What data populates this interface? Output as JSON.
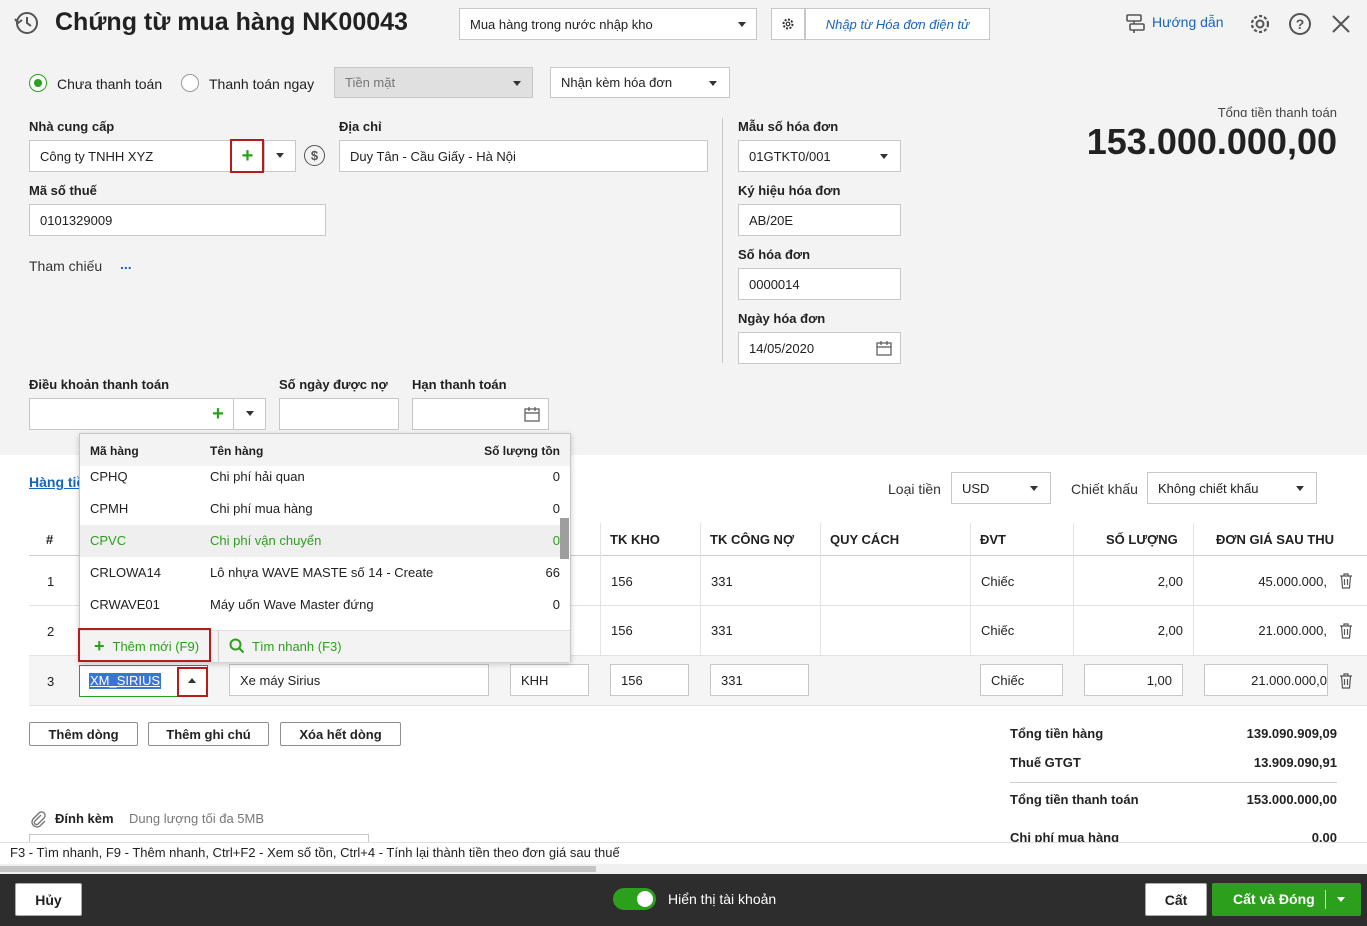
{
  "header": {
    "title": "Chứng từ mua hàng NK00043",
    "doc_type": "Mua hàng trong nước nhập kho",
    "import_einvoice": "Nhập từ Hóa đơn điện tử",
    "help": "Hướng dẫn"
  },
  "payment": {
    "unpaid": "Chưa thanh toán",
    "pay_now": "Thanh toán ngay",
    "method": "Tiền mặt",
    "invoice_mode": "Nhận kèm hóa đơn"
  },
  "total": {
    "label": "Tổng tiền thanh toán",
    "value": "153.000.000,00"
  },
  "supplier": {
    "label": "Nhà cung cấp",
    "value": "Công ty TNHH XYZ",
    "address_label": "Địa chỉ",
    "address": "Duy Tân - Cầu Giấy - Hà Nội",
    "tax_label": "Mã số thuế",
    "tax": "0101329009",
    "ref_label": "Tham chiếu",
    "ref_value": "..."
  },
  "invoice": {
    "form_label": "Mẫu số hóa đơn",
    "form": "01GTKT0/001",
    "sign_label": "Ký hiệu hóa đơn",
    "sign": "AB/20E",
    "number_label": "Số hóa đơn",
    "number": "0000014",
    "date_label": "Ngày hóa đơn",
    "date": "14/05/2020"
  },
  "terms": {
    "terms_label": "Điều khoản thanh toán",
    "days_label": "Số ngày được nợ",
    "due_label": "Hạn thanh toán"
  },
  "tabs": {
    "goods": "Hàng tiề"
  },
  "currency": {
    "label": "Loại tiền",
    "value": "USD",
    "discount_label": "Chiết khấu",
    "discount": "Không chiết khấu"
  },
  "columns": {
    "num": "#",
    "tk_kho": "TK KHO",
    "tk_cong_no": "TK CÔNG NỢ",
    "quy_cach": "QUY CÁCH",
    "dvt": "ĐVT",
    "so_luong": "SỐ LƯỢNG",
    "don_gia": "ĐƠN GIÁ SAU THU"
  },
  "rows": [
    {
      "num": "1",
      "tk_kho": "156",
      "tk_cong_no": "331",
      "dvt": "Chiếc",
      "so_luong": "2,00",
      "don_gia": "45.000.000,"
    },
    {
      "num": "2",
      "tk_kho": "156",
      "tk_cong_no": "331",
      "dvt": "Chiếc",
      "so_luong": "2,00",
      "don_gia": "21.000.000,"
    },
    {
      "num": "3",
      "code": "XM_SIRIUS",
      "name": "Xe máy Sirius",
      "unit_code": "KHH",
      "tk_kho": "156",
      "tk_cong_no": "331",
      "dvt": "Chiếc",
      "so_luong": "1,00",
      "don_gia": "21.000.000,0"
    }
  ],
  "dropdown": {
    "col_code": "Mã hàng",
    "col_name": "Tên hàng",
    "col_stock": "Số lượng tồn",
    "items": [
      {
        "code": "CPHQ",
        "name": "Chi phí hải quan",
        "stock": "0"
      },
      {
        "code": "CPMH",
        "name": "Chi phí mua hàng",
        "stock": "0"
      },
      {
        "code": "CPVC",
        "name": "Chi phí vận chuyển",
        "stock": "0"
      },
      {
        "code": "CRLOWA14",
        "name": "Lô nhựa WAVE MASTE số 14 - Create",
        "stock": "66"
      },
      {
        "code": "CRWAVE01",
        "name": "Máy uốn Wave Master đứng",
        "stock": "0"
      }
    ],
    "add_new": "Thêm mới (F9)",
    "quick_search": "Tìm nhanh (F3)"
  },
  "actions": {
    "add_row": "Thêm dòng",
    "add_note": "Thêm ghi chú",
    "clear_rows": "Xóa hết dòng"
  },
  "summary": {
    "goods_label": "Tổng tiền hàng",
    "goods": "139.090.909,09",
    "vat_label": "Thuế GTGT",
    "vat": "13.909.090,91",
    "total_label": "Tổng tiền thanh toán",
    "total": "153.000.000,00",
    "cost_label": "Chi phí mua hàng",
    "cost": "0,00"
  },
  "attach": {
    "label": "Đính kèm",
    "hint": "Dung lượng tối đa 5MB"
  },
  "hint_bar": "F3 - Tìm nhanh, F9 - Thêm nhanh, Ctrl+F2 - Xem số tồn, Ctrl+4 - Tính lại thành tiền theo đơn giá sau thuế",
  "footer": {
    "cancel": "Hủy",
    "show_account": "Hiển thị tài khoản",
    "save": "Cất",
    "save_close": "Cất và Đóng"
  },
  "colors": {
    "accent": "#2ca01c",
    "link": "#1565c0",
    "footer_bg": "#2d2d2d",
    "highlight_red": "#b71c1c"
  }
}
